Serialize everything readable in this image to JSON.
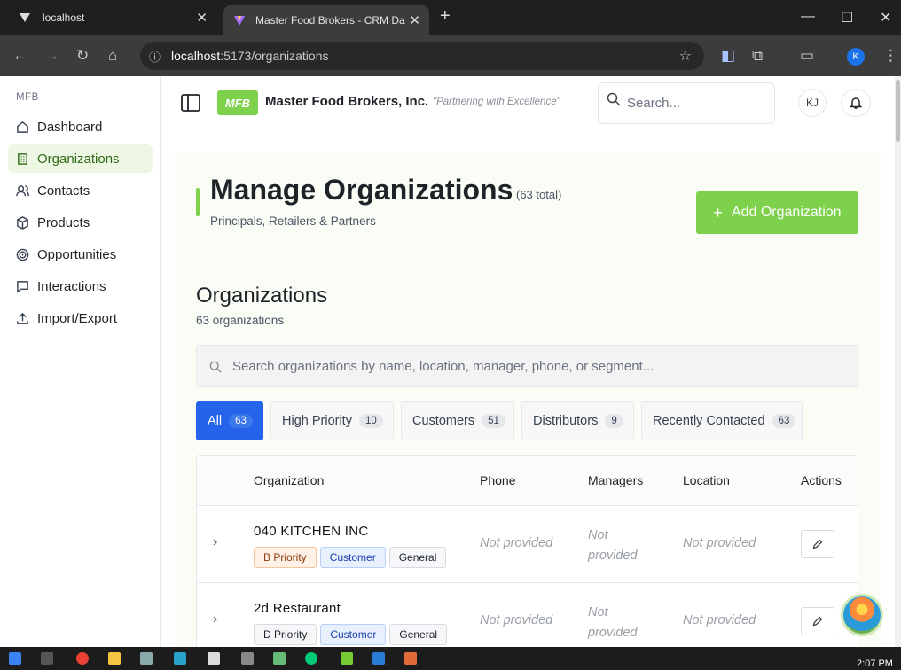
{
  "browser": {
    "tabs": [
      {
        "title": "localhost"
      },
      {
        "title": "Master Food Brokers - CRM Da"
      }
    ],
    "url_host": "localhost",
    "url_path": ":5173/organizations",
    "profile_initial": "K"
  },
  "sidebar": {
    "brand": "MFB",
    "items": [
      {
        "label": "Dashboard",
        "icon": "home-icon"
      },
      {
        "label": "Organizations",
        "icon": "building-icon"
      },
      {
        "label": "Contacts",
        "icon": "users-icon"
      },
      {
        "label": "Products",
        "icon": "package-icon"
      },
      {
        "label": "Opportunities",
        "icon": "target-icon"
      },
      {
        "label": "Interactions",
        "icon": "message-icon"
      },
      {
        "label": "Import/Export",
        "icon": "upload-icon"
      }
    ],
    "active_index": 1
  },
  "header": {
    "logo_text": "MFB",
    "company": "Master Food Brokers, Inc.",
    "tagline": "\"Partnering with Excellence\"",
    "search_placeholder": "Search...",
    "user_initials": "KJ"
  },
  "page": {
    "title": "Manage Organizations",
    "total": "(63 total)",
    "subtitle": "Principals, Retailers & Partners",
    "add_button": "Add Organization"
  },
  "section": {
    "title": "Organizations",
    "count": "63 organizations",
    "search_placeholder": "Search organizations by name, location, manager, phone, or segment...",
    "filters": [
      {
        "label": "All",
        "count": "63"
      },
      {
        "label": "High Priority",
        "count": "10"
      },
      {
        "label": "Customers",
        "count": "51"
      },
      {
        "label": "Distributors",
        "count": "9"
      },
      {
        "label": "Recently Contacted",
        "count": "63"
      }
    ]
  },
  "table": {
    "headers": [
      "Organization",
      "Phone",
      "Managers",
      "Location",
      "Actions"
    ],
    "rows": [
      {
        "name": "040 KITCHEN INC",
        "priority": "B Priority",
        "type": "Customer",
        "segment": "General",
        "phone": "Not provided",
        "managers": "Not provided",
        "location": "Not provided"
      },
      {
        "name": "2d Restaurant",
        "priority": "D Priority",
        "type": "Customer",
        "segment": "General",
        "phone": "Not provided",
        "managers": "Not provided",
        "location": "Not provided"
      }
    ]
  },
  "taskbar": {
    "time": "2:07 PM"
  },
  "colors": {
    "accent": "#7ed14a",
    "primary": "#2563eb"
  }
}
